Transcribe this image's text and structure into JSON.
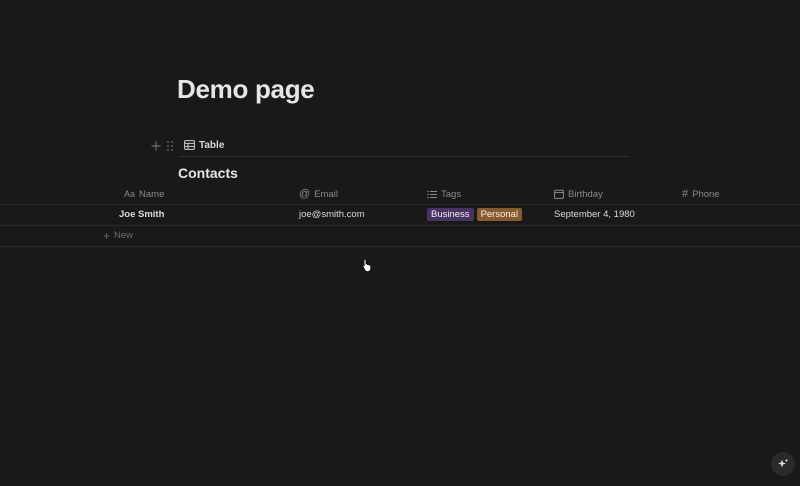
{
  "page": {
    "title": "Demo page"
  },
  "view": {
    "tab_label": "Table"
  },
  "database": {
    "title": "Contacts",
    "columns": [
      {
        "label": "Name",
        "icon": "aa-text-icon"
      },
      {
        "label": "Email",
        "icon": "at-icon"
      },
      {
        "label": "Tags",
        "icon": "list-icon"
      },
      {
        "label": "Birthday",
        "icon": "calendar-icon"
      },
      {
        "label": "Phone",
        "icon": "hash-icon"
      }
    ],
    "rows": [
      {
        "name": "Joe Smith",
        "email": "joe@smith.com",
        "tags": [
          "Business",
          "Personal"
        ],
        "birthday": "September 4, 1980",
        "phone": ""
      }
    ],
    "new_label": "New"
  },
  "colors": {
    "background": "#191919",
    "tag_business": "#4a3266",
    "tag_personal": "#8a5a2b"
  }
}
